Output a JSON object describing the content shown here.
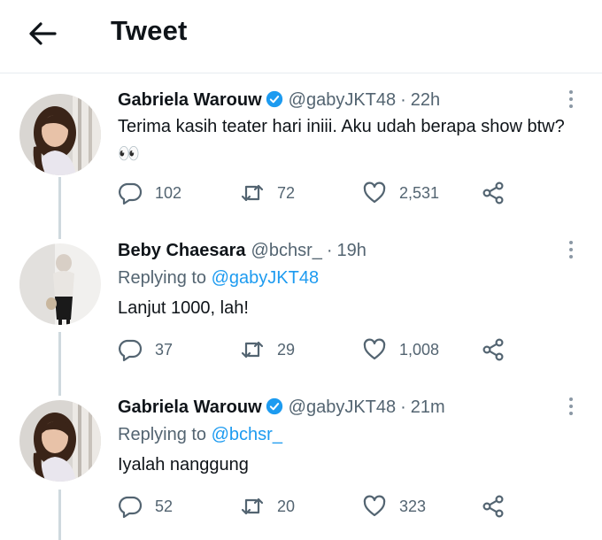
{
  "header": {
    "title": "Tweet"
  },
  "tweets": [
    {
      "name": "Gabriela Warouw",
      "handle": "@gabyJKT48",
      "dot": "·",
      "time": "22h",
      "replying_label": "",
      "replying_to": "",
      "text": "Terima kasih teater hari iniii. Aku udah berapa show btw? 👀",
      "replies": "102",
      "retweets": "72",
      "likes": "2,531"
    },
    {
      "name": "Beby Chaesara",
      "handle": "@bchsr_",
      "dot": "·",
      "time": "19h",
      "replying_label": "Replying to",
      "replying_to": "@gabyJKT48",
      "text": "Lanjut 1000, lah!",
      "replies": "37",
      "retweets": "29",
      "likes": "1,008"
    },
    {
      "name": "Gabriela Warouw",
      "handle": "@gabyJKT48",
      "dot": "·",
      "time": "21m",
      "replying_label": "Replying to",
      "replying_to": "@bchsr_",
      "text": "Iyalah nanggung",
      "replies": "52",
      "retweets": "20",
      "likes": "323"
    }
  ],
  "colors": {
    "link": "#1d9bf0",
    "secondary": "#536471",
    "verified": "#1d9bf0"
  },
  "icons": [
    "back-arrow-icon",
    "verified-badge-icon",
    "more-options-icon",
    "reply-icon",
    "retweet-icon",
    "like-icon",
    "share-icon"
  ]
}
